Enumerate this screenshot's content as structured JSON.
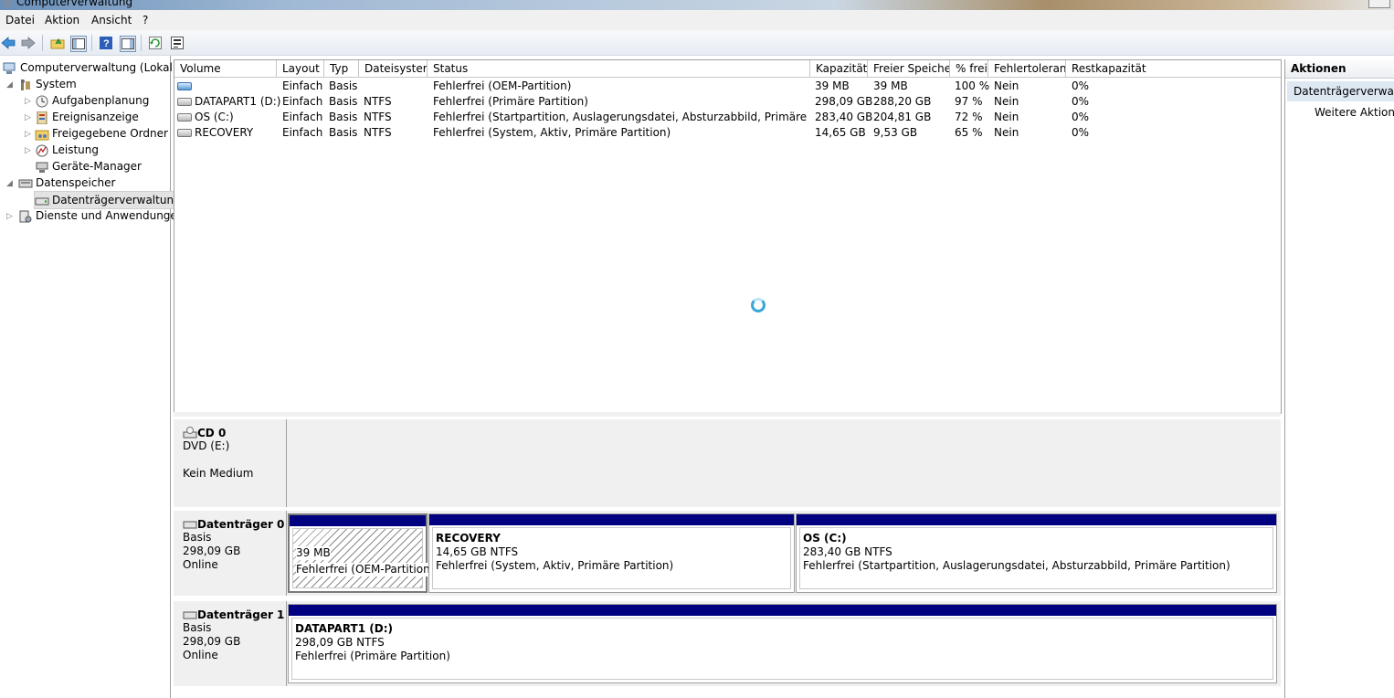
{
  "window": {
    "title": "Computerverwaltung"
  },
  "menu": {
    "items": [
      "Datei",
      "Aktion",
      "Ansicht",
      "?"
    ]
  },
  "toolbar": {
    "icons": [
      "back-arrow-icon",
      "forward-arrow-icon",
      "up-folder-icon",
      "show-hide-tree-icon",
      "help-icon",
      "show-hide-action-pane-icon",
      "refresh-icon",
      "properties-icon"
    ]
  },
  "tree": {
    "root": "Computerverwaltung (Lokal)",
    "system": "System",
    "aufgabenplanung": "Aufgabenplanung",
    "ereignisanzeige": "Ereignisanzeige",
    "freigegebene_ordner": "Freigegebene Ordner",
    "leistung": "Leistung",
    "geraete_manager": "Geräte-Manager",
    "datenspeicher": "Datenspeicher",
    "datentraegerverwaltung": "Datenträgerverwaltung",
    "dienste": "Dienste und Anwendungen"
  },
  "volumes": {
    "headers": [
      "Volume",
      "Layout",
      "Typ",
      "Dateisystem",
      "Status",
      "Kapazität",
      "Freier Speicher",
      "% frei",
      "Fehlertoleranz",
      "Restkapazität"
    ],
    "rows": [
      {
        "volume": "",
        "layout": "Einfach",
        "typ": "Basis",
        "fs": "",
        "status": "Fehlerfrei (OEM-Partition)",
        "kap": "39 MB",
        "frei": "39 MB",
        "pfrei": "100 %",
        "ft": "Nein",
        "rest": "0%"
      },
      {
        "volume": "DATAPART1 (D:)",
        "layout": "Einfach",
        "typ": "Basis",
        "fs": "NTFS",
        "status": "Fehlerfrei (Primäre Partition)",
        "kap": "298,09 GB",
        "frei": "288,20 GB",
        "pfrei": "97 %",
        "ft": "Nein",
        "rest": "0%"
      },
      {
        "volume": "OS (C:)",
        "layout": "Einfach",
        "typ": "Basis",
        "fs": "NTFS",
        "status": "Fehlerfrei (Startpartition, Auslagerungsdatei, Absturzabbild, Primäre Partition)",
        "kap": "283,40 GB",
        "frei": "204,81 GB",
        "pfrei": "72 %",
        "ft": "Nein",
        "rest": "0%"
      },
      {
        "volume": "RECOVERY",
        "layout": "Einfach",
        "typ": "Basis",
        "fs": "NTFS",
        "status": "Fehlerfrei (System, Aktiv, Primäre Partition)",
        "kap": "14,65 GB",
        "frei": "9,53 GB",
        "pfrei": "65 %",
        "ft": "Nein",
        "rest": "0%"
      }
    ]
  },
  "disks": {
    "cd0": {
      "name": "CD 0",
      "line1": "DVD (E:)",
      "line2": "Kein Medium"
    },
    "disk0": {
      "name": "Datenträger 0",
      "type": "Basis",
      "size": "298,09 GB",
      "state": "Online",
      "parts": [
        {
          "title": "",
          "size": "39 MB",
          "status": "Fehlerfrei (OEM-Partition)"
        },
        {
          "title": "RECOVERY",
          "size": "14,65 GB NTFS",
          "status": "Fehlerfrei (System, Aktiv, Primäre Partition)"
        },
        {
          "title": "OS  (C:)",
          "size": "283,40 GB NTFS",
          "status": "Fehlerfrei (Startpartition, Auslagerungsdatei, Absturzabbild, Primäre Partition)"
        }
      ]
    },
    "disk1": {
      "name": "Datenträger 1",
      "type": "Basis",
      "size": "298,09 GB",
      "state": "Online",
      "parts": [
        {
          "title": "DATAPART1  (D:)",
          "size": "298,09 GB NTFS",
          "status": "Fehlerfrei (Primäre Partition)"
        }
      ]
    }
  },
  "actions": {
    "header": "Aktionen",
    "section": "Datenträgerverwaltung",
    "more": "Weitere Aktionen"
  },
  "colors": {
    "partition_bar": "#000080",
    "selection": "#dde8f3",
    "spinner": "#3aa6d8"
  }
}
